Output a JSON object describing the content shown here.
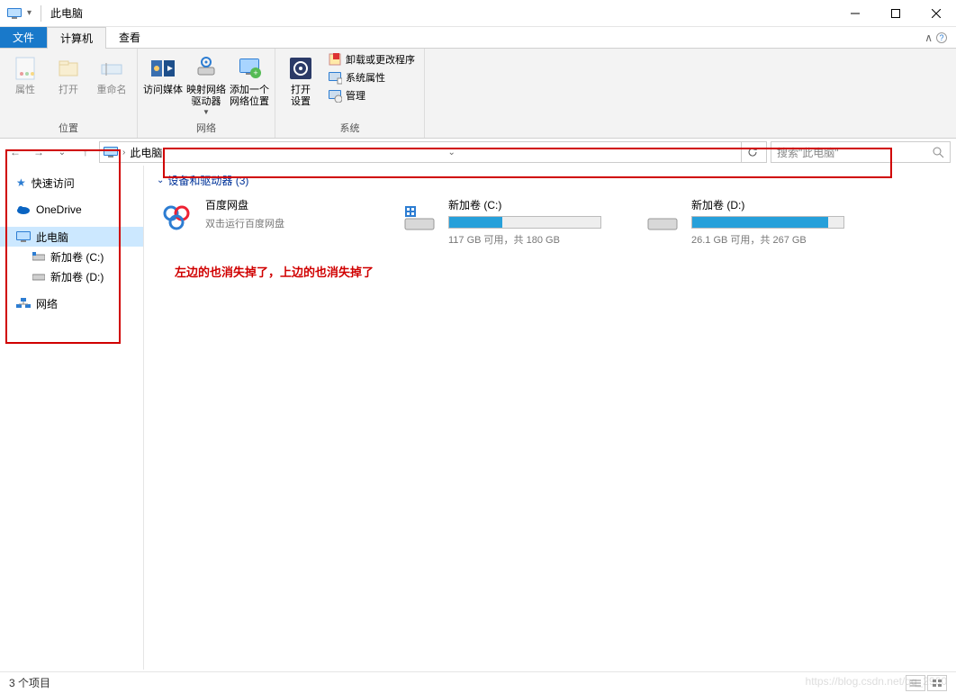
{
  "window": {
    "title": "此电脑"
  },
  "tabs": {
    "file": "文件",
    "computer": "计算机",
    "view": "查看"
  },
  "ribbon": {
    "location_group": "位置",
    "network_group": "网络",
    "system_group": "系统",
    "properties": "属性",
    "open": "打开",
    "rename": "重命名",
    "access_media": "访问媒体",
    "map_drive": "映射网络\n驱动器",
    "add_location": "添加一个\n网络位置",
    "open_settings": "打开\n设置",
    "uninstall": "卸载或更改程序",
    "sys_props": "系统属性",
    "manage": "管理"
  },
  "nav": {
    "current": "此电脑",
    "search_placeholder": "搜索\"此电脑\""
  },
  "sidebar": {
    "quick": "快速访问",
    "onedrive": "OneDrive",
    "thispc": "此电脑",
    "drive_c": "新加卷 (C:)",
    "drive_d": "新加卷 (D:)",
    "network": "网络"
  },
  "content": {
    "group_header": "设备和驱动器 (3)",
    "items": [
      {
        "name": "百度网盘",
        "sub": "双击运行百度网盘",
        "type": "app"
      },
      {
        "name": "新加卷 (C:)",
        "sub": "117 GB 可用，共 180 GB",
        "type": "drive",
        "fill_pct": 35
      },
      {
        "name": "新加卷 (D:)",
        "sub": "26.1 GB 可用，共 267 GB",
        "type": "drive",
        "fill_pct": 90
      }
    ],
    "annotation": "左边的也消失掉了，上边的也消失掉了"
  },
  "status": {
    "items": "3 个项目"
  },
  "watermark": "https://blog.csdn.net/qq_2900"
}
